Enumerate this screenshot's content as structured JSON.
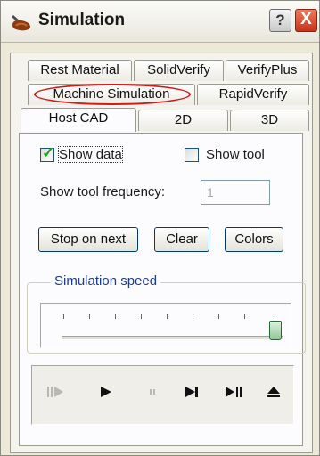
{
  "window": {
    "title": "Simulation",
    "help_label": "?",
    "close_label": "X"
  },
  "tabs_row1": [
    {
      "label": "Rest Material"
    },
    {
      "label": "SolidVerify"
    },
    {
      "label": "VerifyPlus"
    }
  ],
  "tabs_row2": [
    {
      "label": "Machine Simulation"
    },
    {
      "label": "RapidVerify"
    }
  ],
  "tabs_row3": [
    {
      "label": "Host CAD"
    },
    {
      "label": "2D"
    },
    {
      "label": "3D"
    }
  ],
  "active_tab": "Host CAD",
  "highlighted_tab": "Machine Simulation",
  "options": {
    "show_data": {
      "label": "Show data",
      "checked": true
    },
    "show_tool": {
      "label": "Show tool",
      "checked": false
    },
    "frequency_label": "Show tool frequency:",
    "frequency_value": "1"
  },
  "buttons": {
    "stop_on_next": "Stop on next",
    "clear": "Clear",
    "colors": "Colors"
  },
  "speed": {
    "label": "Simulation speed",
    "value_fraction": 1.0
  },
  "playback": [
    {
      "icon": "step-play-icon",
      "enabled": false
    },
    {
      "icon": "play-icon",
      "enabled": true
    },
    {
      "icon": "pause-icon",
      "enabled": false
    },
    {
      "icon": "skip-to-end-icon",
      "enabled": true
    },
    {
      "icon": "play-to-end-icon",
      "enabled": true
    },
    {
      "icon": "eject-icon",
      "enabled": true
    }
  ],
  "colors": {
    "accent_red": "#d41818",
    "group_label": "#1f3d8e",
    "check_green": "#21a121"
  }
}
